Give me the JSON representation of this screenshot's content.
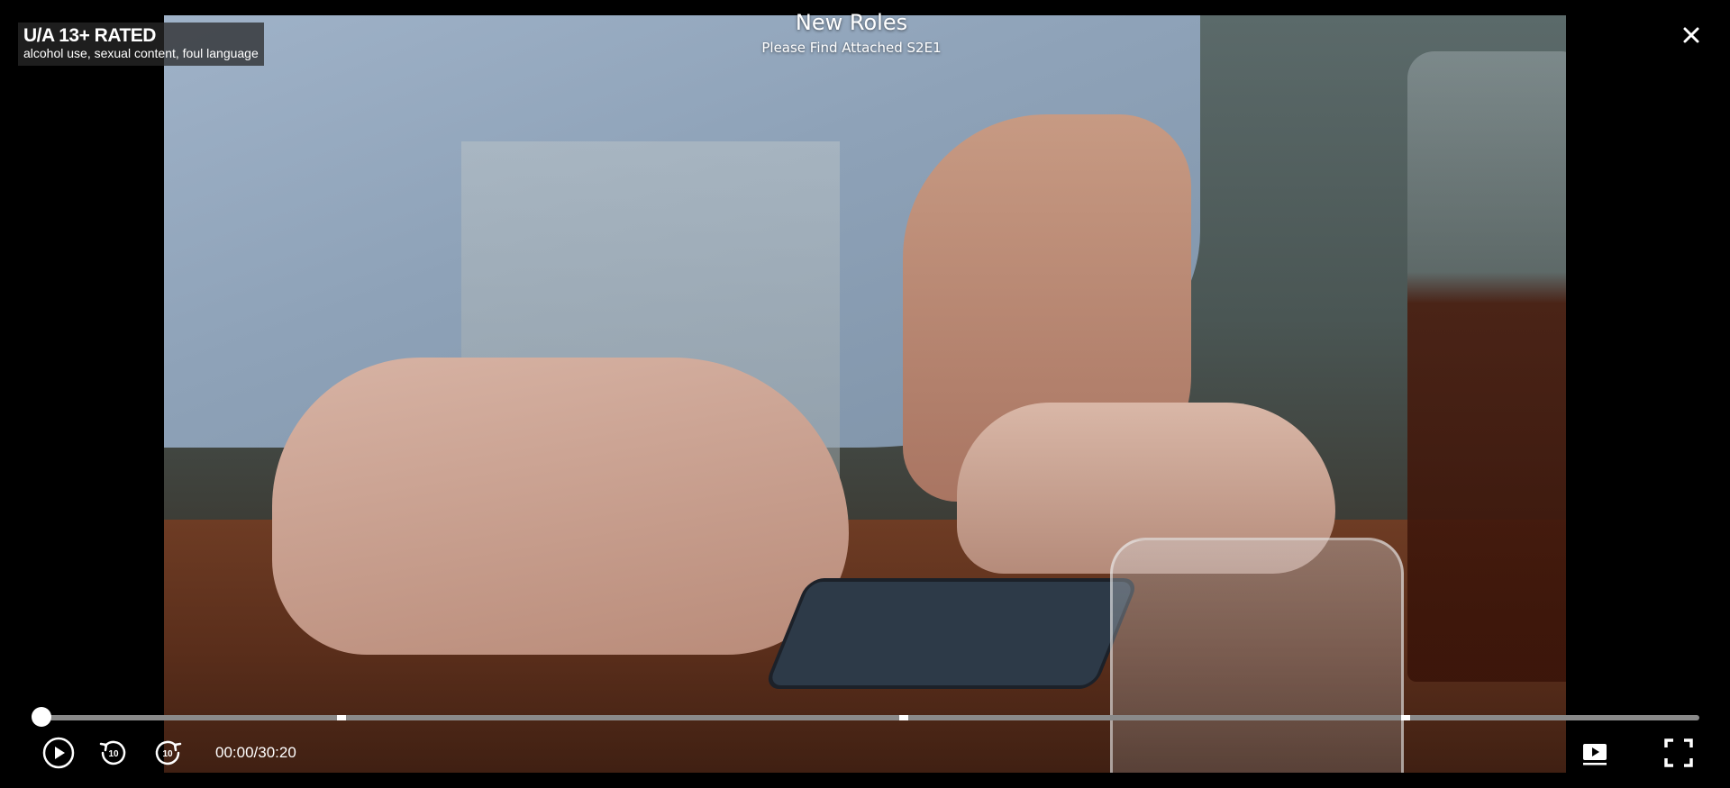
{
  "rating": {
    "title": "U/A 13+ RATED",
    "descriptors": "alcohol use, sexual content, foul language"
  },
  "episode": {
    "title": "New Roles",
    "subtitle": "Please Find Attached S2E1"
  },
  "playback": {
    "elapsed": "00:00",
    "total": "30:20",
    "time_display": "00:00/30:20",
    "progress_fraction": 0.0,
    "chapter_marker_fractions": [
      0.181,
      0.52,
      0.823
    ]
  },
  "icons": {
    "close": "close-icon",
    "play": "play-icon",
    "rewind": "rewind-10-icon",
    "forward": "forward-10-icon",
    "next_episode": "next-episode-icon",
    "fullscreen": "fullscreen-icon"
  },
  "colors": {
    "background": "#000000",
    "progress_track": "#8a8a8a",
    "progress_fill": "#ffffff"
  }
}
